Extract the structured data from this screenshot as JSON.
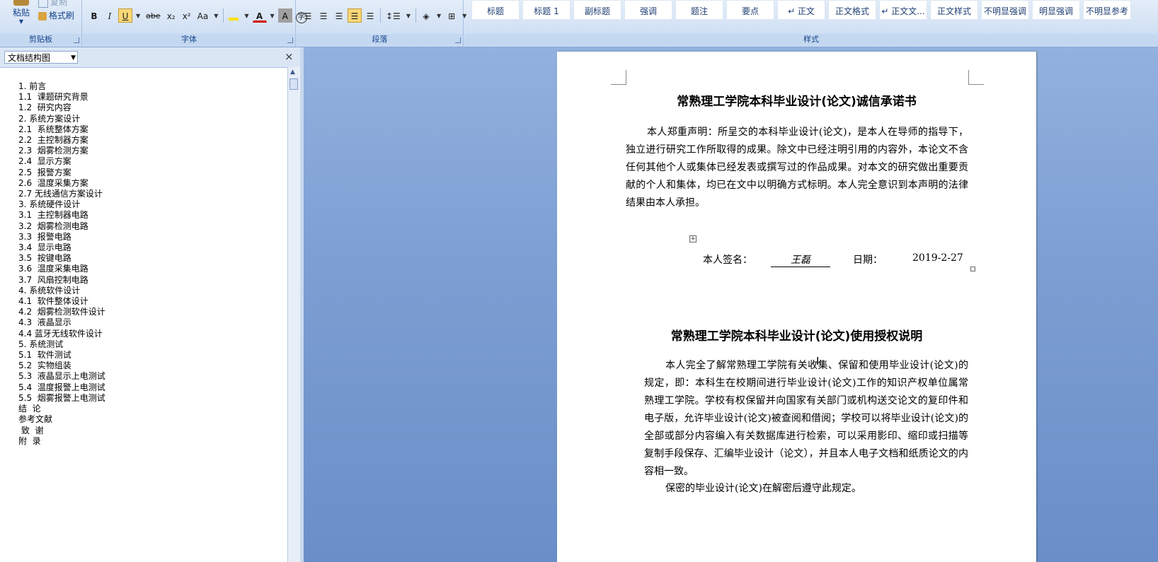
{
  "ribbon": {
    "clipboard": {
      "label": "剪贴板",
      "paste": "粘贴",
      "copy": "复制",
      "format_painter": "格式刷"
    },
    "font": {
      "label": "字体",
      "buttons": [
        "B",
        "I",
        "U",
        "abe",
        "x₂",
        "x²",
        "Aa",
        "A",
        "A"
      ]
    },
    "paragraph": {
      "label": "段落"
    },
    "styles": {
      "label": "样式",
      "items": [
        "标题",
        "标题 1",
        "副标题",
        "强调",
        "题注",
        "要点",
        "↵ 正文",
        "正文格式",
        "↵ 正文文...",
        "正文样式",
        "不明显强调",
        "明显强调",
        "不明显参考"
      ]
    }
  },
  "nav": {
    "view_select": "文档结构图",
    "close": "×",
    "outline": [
      "1. 前言",
      "1.1  课题研究背景",
      "1.2  研究内容",
      "2. 系统方案设计",
      "2.1  系统整体方案",
      "2.2  主控制器方案",
      "2.3  烟雾检测方案",
      "2.4  显示方案",
      "2.5  报警方案",
      "2.6  温度采集方案",
      "2.7 无线通信方案设计",
      "3. 系统硬件设计",
      "3.1  主控制器电路",
      "3.2  烟雾检测电路",
      "3.3  报警电路",
      "3.4  显示电路",
      "3.5  按键电路",
      "3.6  温度采集电路",
      "3.7  风扇控制电路",
      "4. 系统软件设计",
      "4.1  软件整体设计",
      "4.2  烟雾检测软件设计",
      "4.3  液晶显示",
      "4.4 蓝牙无线软件设计",
      "5. 系统测试",
      "5.1  软件测试",
      "5.2  实物组装",
      "5.3  液晶显示上电测试",
      "5.4  温度报警上电测试",
      "5.5  烟雾报警上电测试",
      "结  论",
      "参考文献",
      " 致  谢",
      "附  录"
    ]
  },
  "document": {
    "title1": "常熟理工学院本科毕业设计(论文)诚信承诺书",
    "para1": "本人郑重声明：所呈交的本科毕业设计(论文)，是本人在导师的指导下，独立进行研究工作所取得的成果。除文中已经注明引用的内容外，本论文不含任何其他个人或集体已经发表或撰写过的作品成果。对本文的研究做出重要贡献的个人和集体，均已在文中以明确方式标明。本人完全意识到本声明的法律结果由本人承担。",
    "sign_label": "本人签名：",
    "sign_name": "王磊",
    "date_label": "日期：",
    "date_value": "2019-2-27",
    "title2": "常熟理工学院本科毕业设计(论文)使用授权说明",
    "para2": "本人完全了解常熟理工学院有关收集、保留和使用毕业设计(论文)的规定，即：本科生在校期间进行毕业设计(论文)工作的知识产权单位属常熟理工学院。学校有权保留并向国家有关部门或机构送交论文的复印件和电子版，允许毕业设计(论文)被查阅和借阅；学校可以将毕业设计(论文)的全部或部分内容编入有关数据库进行检索，可以采用影印、缩印或扫描等复制手段保存、汇编毕业设计（论文），并且本人电子文档和纸质论文的内容相一致。",
    "para3": "保密的毕业设计(论文)在解密后遵守此规定。"
  }
}
